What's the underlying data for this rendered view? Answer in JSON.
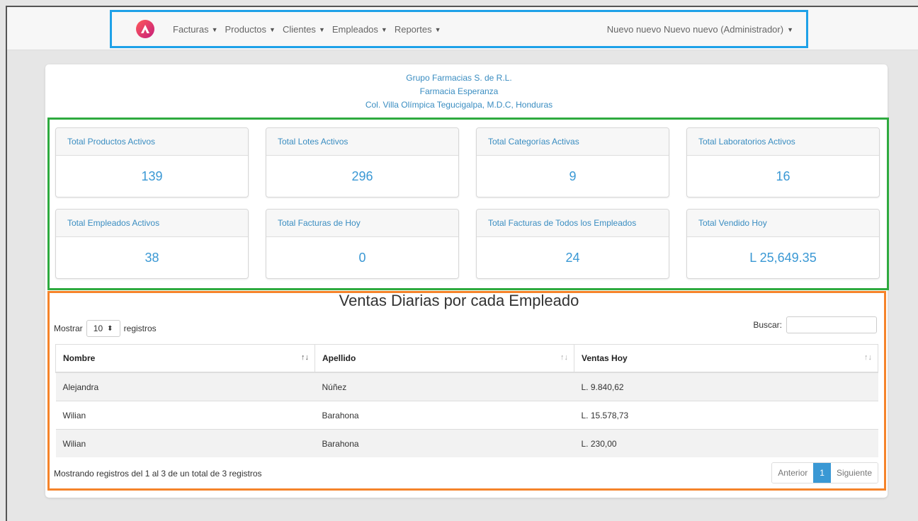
{
  "nav": {
    "items": [
      {
        "label": "Facturas"
      },
      {
        "label": "Productos"
      },
      {
        "label": "Clientes"
      },
      {
        "label": "Empleados"
      },
      {
        "label": "Reportes"
      }
    ],
    "user": "Nuevo nuevo Nuevo nuevo (Administrador)"
  },
  "company": {
    "line1": "Grupo Farmacias S. de R.L.",
    "line2": "Farmacia Esperanza",
    "line3": "Col. Villa Olímpica Tegucigalpa, M.D.C, Honduras"
  },
  "stats": [
    {
      "label": "Total Productos Activos",
      "value": "139"
    },
    {
      "label": "Total Lotes Activos",
      "value": "296"
    },
    {
      "label": "Total Categorías Activas",
      "value": "9"
    },
    {
      "label": "Total Laboratorios Activos",
      "value": "16"
    },
    {
      "label": "Total Empleados Activos",
      "value": "38"
    },
    {
      "label": "Total Facturas de Hoy",
      "value": "0"
    },
    {
      "label": "Total Facturas de Todos los Empleados",
      "value": "24"
    },
    {
      "label": "Total Vendido Hoy",
      "value": "L 25,649.35"
    }
  ],
  "table": {
    "title": "Ventas Diarias por cada Empleado",
    "show_label": "Mostrar",
    "show_value": "10",
    "records_label": "registros",
    "search_label": "Buscar:",
    "columns": [
      "Nombre",
      "Apellido",
      "Ventas Hoy"
    ],
    "rows": [
      {
        "nombre": "Alejandra",
        "apellido": "Núñez",
        "ventas": "L. 9.840,62"
      },
      {
        "nombre": "Wilian",
        "apellido": "Barahona",
        "ventas": "L. 15.578,73"
      },
      {
        "nombre": "Wilian",
        "apellido": "Barahona",
        "ventas": "L. 230,00"
      }
    ],
    "info": "Mostrando registros del 1 al 3 de un total de 3 registros",
    "prev": "Anterior",
    "page": "1",
    "next": "Siguiente"
  },
  "colors": {
    "nav_highlight": "#1ea1e8",
    "stats_highlight": "#2eaa3f",
    "table_highlight": "#f5832a",
    "accent": "#3a98d4"
  }
}
